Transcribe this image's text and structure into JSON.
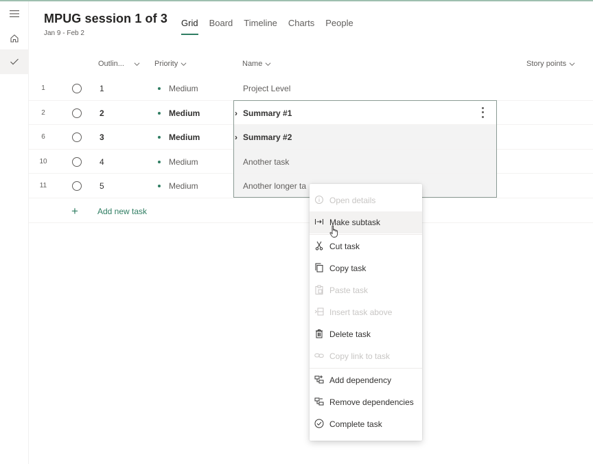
{
  "plan": {
    "title": "MPUG session 1 of 3",
    "dates": "Jan 9 - Feb 2"
  },
  "tabs": [
    {
      "label": "Grid",
      "active": true
    },
    {
      "label": "Board"
    },
    {
      "label": "Timeline"
    },
    {
      "label": "Charts"
    },
    {
      "label": "People"
    }
  ],
  "columns": {
    "outline": "Outlin...",
    "priority": "Priority",
    "name": "Name",
    "story_points": "Story points"
  },
  "rows": [
    {
      "num": "1",
      "outline": "1",
      "priority": "Medium",
      "name": "Project Level"
    },
    {
      "num": "2",
      "outline": "2",
      "priority": "Medium",
      "name": "Summary #1"
    },
    {
      "num": "6",
      "outline": "3",
      "priority": "Medium",
      "name": "Summary #2"
    },
    {
      "num": "10",
      "outline": "4",
      "priority": "Medium",
      "name": "Another task"
    },
    {
      "num": "11",
      "outline": "5",
      "priority": "Medium",
      "name": "Another longer ta"
    }
  ],
  "add_task": {
    "label": "Add new task",
    "plus": "+"
  },
  "caret": "›",
  "context_menu": {
    "items": [
      {
        "label": "Open details",
        "icon": "info-icon",
        "enabled": false
      },
      {
        "label": "Make subtask",
        "icon": "indent-icon",
        "enabled": true,
        "hover": true
      },
      {
        "label": "Cut task",
        "icon": "scissors-icon",
        "enabled": true
      },
      {
        "label": "Copy task",
        "icon": "copy-icon",
        "enabled": true
      },
      {
        "label": "Paste task",
        "icon": "clipboard-icon",
        "enabled": false
      },
      {
        "label": "Insert task above",
        "icon": "insert-above-icon",
        "enabled": false
      },
      {
        "label": "Delete task",
        "icon": "trash-icon",
        "enabled": true
      },
      {
        "label": "Copy link to task",
        "icon": "link-icon",
        "enabled": false
      },
      {
        "label": "Add dependency",
        "icon": "add-dependency-icon",
        "enabled": true
      },
      {
        "label": "Remove dependencies",
        "icon": "remove-dependency-icon",
        "enabled": true
      },
      {
        "label": "Complete task",
        "icon": "check-circle-icon",
        "enabled": true
      }
    ]
  },
  "colors": {
    "accent": "#2f7d62",
    "text": "#323130",
    "muted": "#605e5c",
    "disabled": "#c8c6c4"
  }
}
